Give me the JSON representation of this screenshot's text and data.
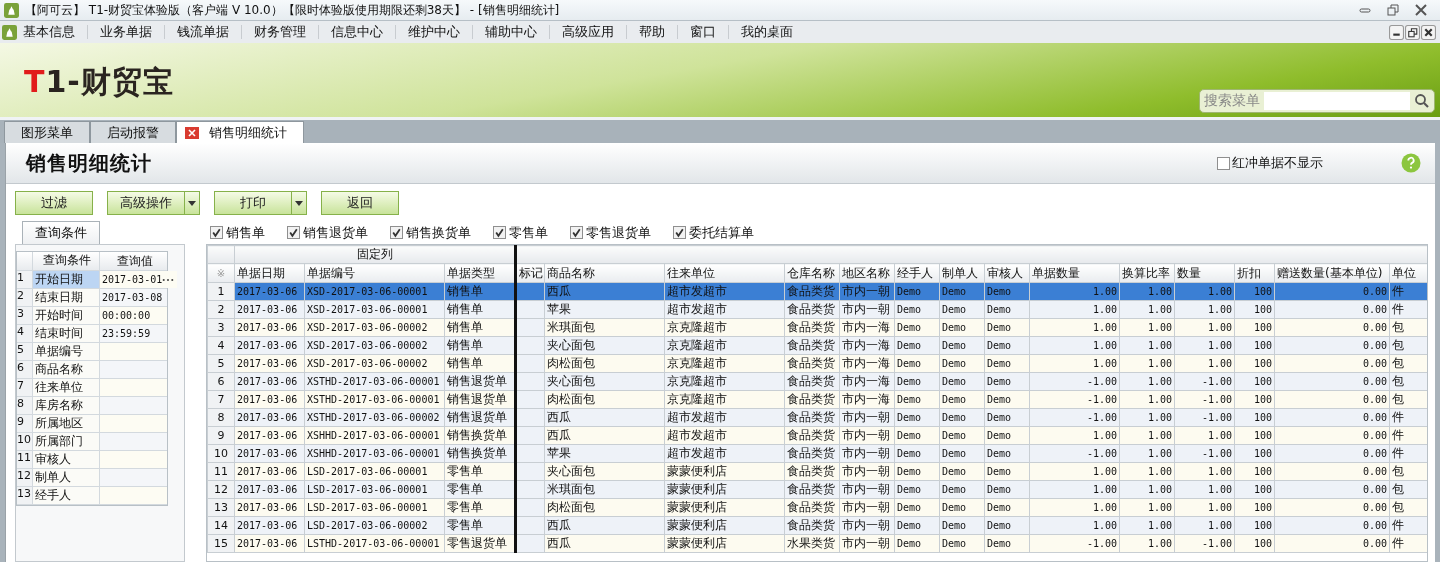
{
  "window": {
    "title": "【阿可云】 T1-财贸宝体验版（客户端 V 10.0）【限时体验版使用期限还剩38天】 - [销售明细统计]"
  },
  "menu": [
    "基本信息",
    "业务单据",
    "钱流单据",
    "财务管理",
    "信息中心",
    "维护中心",
    "辅助中心",
    "高级应用",
    "帮助",
    "窗口",
    "我的桌面"
  ],
  "logo": {
    "mark": "T",
    "text": "1-财贸宝"
  },
  "search": {
    "label": "搜索菜单"
  },
  "tabs": [
    {
      "label": "图形菜单",
      "selected": false,
      "closable": false
    },
    {
      "label": "启动报警",
      "selected": false,
      "closable": false
    },
    {
      "label": "销售明细统计",
      "selected": true,
      "closable": true
    }
  ],
  "page": {
    "title": "销售明细统计",
    "hide_red": {
      "label": "红冲单据不显示",
      "checked": false
    }
  },
  "buttons": [
    {
      "label": "过滤",
      "dropdown": false
    },
    {
      "label": "高级操作",
      "dropdown": true
    },
    {
      "label": "打印",
      "dropdown": true
    },
    {
      "label": "返回",
      "dropdown": false
    }
  ],
  "query": {
    "tab": "查询条件",
    "columns": [
      "查询条件",
      "查询值"
    ],
    "rows": [
      {
        "num": "1",
        "label": "开始日期",
        "value": "2017-03-01",
        "selected": true
      },
      {
        "num": "2",
        "label": "结束日期",
        "value": "2017-03-08",
        "selected": false
      },
      {
        "num": "3",
        "label": "开始时间",
        "value": "00:00:00",
        "selected": false
      },
      {
        "num": "4",
        "label": "结束时间",
        "value": "23:59:59",
        "selected": false
      },
      {
        "num": "5",
        "label": "单据编号",
        "selected": false
      },
      {
        "num": "6",
        "label": "商品名称",
        "selected": false
      },
      {
        "num": "7",
        "label": "往来单位",
        "selected": false
      },
      {
        "num": "8",
        "label": "库房名称",
        "selected": false
      },
      {
        "num": "9",
        "label": "所属地区",
        "selected": false
      },
      {
        "num": "10",
        "label": "所属部门",
        "selected": false
      },
      {
        "num": "11",
        "label": "审核人",
        "selected": false
      },
      {
        "num": "12",
        "label": "制单人",
        "selected": false
      },
      {
        "num": "13",
        "label": "经手人",
        "selected": false
      }
    ]
  },
  "filters": [
    {
      "label": "销售单",
      "checked": true
    },
    {
      "label": "销售退货单",
      "checked": true
    },
    {
      "label": "销售换货单",
      "checked": true
    },
    {
      "label": "零售单",
      "checked": true
    },
    {
      "label": "零售退货单",
      "checked": true
    },
    {
      "label": "委托结算单",
      "checked": true
    }
  ],
  "table": {
    "fixed_label": "固定列",
    "corner": "※",
    "fixed_columns": [
      {
        "label": "单据日期",
        "kind": "mono"
      },
      {
        "label": "单据编号",
        "kind": "mono"
      },
      {
        "label": "单据类型",
        "kind": "text"
      }
    ],
    "columns": [
      {
        "label": "标记",
        "kind": "mark"
      },
      {
        "label": "商品名称",
        "kind": "text"
      },
      {
        "label": "往来单位",
        "kind": "text"
      },
      {
        "label": "仓库名称",
        "kind": "text"
      },
      {
        "label": "地区名称",
        "kind": "text"
      },
      {
        "label": "经手人",
        "kind": "mono"
      },
      {
        "label": "制单人",
        "kind": "mono"
      },
      {
        "label": "审核人",
        "kind": "mono"
      },
      {
        "label": "单据数量",
        "kind": "number"
      },
      {
        "label": "换算比率",
        "kind": "number"
      },
      {
        "label": "数量",
        "kind": "number"
      },
      {
        "label": "折扣",
        "kind": "number"
      },
      {
        "label": "赠送数量(基本单位)",
        "kind": "number"
      },
      {
        "label": "单位",
        "kind": "text"
      }
    ],
    "rows": [
      {
        "num": "1",
        "selected": true,
        "fixed_cells": [
          "2017-03-06",
          "XSD-2017-03-06-00001",
          "销售单"
        ],
        "cells": [
          "",
          "西瓜",
          "超市发超市",
          "食品类货",
          "市内一朝",
          "Demo",
          "Demo",
          "Demo",
          "1.00",
          "1.00",
          "1.00",
          "100",
          "0.00",
          "件"
        ]
      },
      {
        "num": "2",
        "selected": false,
        "fixed_cells": [
          "2017-03-06",
          "XSD-2017-03-06-00001",
          "销售单"
        ],
        "cells": [
          "",
          "苹果",
          "超市发超市",
          "食品类货",
          "市内一朝",
          "Demo",
          "Demo",
          "Demo",
          "1.00",
          "1.00",
          "1.00",
          "100",
          "0.00",
          "件"
        ]
      },
      {
        "num": "3",
        "selected": false,
        "fixed_cells": [
          "2017-03-06",
          "XSD-2017-03-06-00002",
          "销售单"
        ],
        "cells": [
          "",
          "米琪面包",
          "京克隆超市",
          "食品类货",
          "市内一海",
          "Demo",
          "Demo",
          "Demo",
          "1.00",
          "1.00",
          "1.00",
          "100",
          "0.00",
          "包"
        ]
      },
      {
        "num": "4",
        "selected": false,
        "fixed_cells": [
          "2017-03-06",
          "XSD-2017-03-06-00002",
          "销售单"
        ],
        "cells": [
          "",
          "夹心面包",
          "京克隆超市",
          "食品类货",
          "市内一海",
          "Demo",
          "Demo",
          "Demo",
          "1.00",
          "1.00",
          "1.00",
          "100",
          "0.00",
          "包"
        ]
      },
      {
        "num": "5",
        "selected": false,
        "fixed_cells": [
          "2017-03-06",
          "XSD-2017-03-06-00002",
          "销售单"
        ],
        "cells": [
          "",
          "肉松面包",
          "京克隆超市",
          "食品类货",
          "市内一海",
          "Demo",
          "Demo",
          "Demo",
          "1.00",
          "1.00",
          "1.00",
          "100",
          "0.00",
          "包"
        ]
      },
      {
        "num": "6",
        "selected": false,
        "fixed_cells": [
          "2017-03-06",
          "XSTHD-2017-03-06-00001",
          "销售退货单"
        ],
        "cells": [
          "",
          "夹心面包",
          "京克隆超市",
          "食品类货",
          "市内一海",
          "Demo",
          "Demo",
          "Demo",
          "-1.00",
          "1.00",
          "-1.00",
          "100",
          "0.00",
          "包"
        ]
      },
      {
        "num": "7",
        "selected": false,
        "fixed_cells": [
          "2017-03-06",
          "XSTHD-2017-03-06-00001",
          "销售退货单"
        ],
        "cells": [
          "",
          "肉松面包",
          "京克隆超市",
          "食品类货",
          "市内一海",
          "Demo",
          "Demo",
          "Demo",
          "-1.00",
          "1.00",
          "-1.00",
          "100",
          "0.00",
          "包"
        ]
      },
      {
        "num": "8",
        "selected": false,
        "fixed_cells": [
          "2017-03-06",
          "XSTHD-2017-03-06-00002",
          "销售退货单"
        ],
        "cells": [
          "",
          "西瓜",
          "超市发超市",
          "食品类货",
          "市内一朝",
          "Demo",
          "Demo",
          "Demo",
          "-1.00",
          "1.00",
          "-1.00",
          "100",
          "0.00",
          "件"
        ]
      },
      {
        "num": "9",
        "selected": false,
        "fixed_cells": [
          "2017-03-06",
          "XSHHD-2017-03-06-00001",
          "销售换货单"
        ],
        "cells": [
          "",
          "西瓜",
          "超市发超市",
          "食品类货",
          "市内一朝",
          "Demo",
          "Demo",
          "Demo",
          "1.00",
          "1.00",
          "1.00",
          "100",
          "0.00",
          "件"
        ]
      },
      {
        "num": "10",
        "selected": false,
        "fixed_cells": [
          "2017-03-06",
          "XSHHD-2017-03-06-00001",
          "销售换货单"
        ],
        "cells": [
          "",
          "苹果",
          "超市发超市",
          "食品类货",
          "市内一朝",
          "Demo",
          "Demo",
          "Demo",
          "-1.00",
          "1.00",
          "-1.00",
          "100",
          "0.00",
          "件"
        ]
      },
      {
        "num": "11",
        "selected": false,
        "fixed_cells": [
          "2017-03-06",
          "LSD-2017-03-06-00001",
          "零售单"
        ],
        "cells": [
          "",
          "夹心面包",
          "蒙蒙便利店",
          "食品类货",
          "市内一朝",
          "Demo",
          "Demo",
          "Demo",
          "1.00",
          "1.00",
          "1.00",
          "100",
          "0.00",
          "包"
        ]
      },
      {
        "num": "12",
        "selected": false,
        "fixed_cells": [
          "2017-03-06",
          "LSD-2017-03-06-00001",
          "零售单"
        ],
        "cells": [
          "",
          "米琪面包",
          "蒙蒙便利店",
          "食品类货",
          "市内一朝",
          "Demo",
          "Demo",
          "Demo",
          "1.00",
          "1.00",
          "1.00",
          "100",
          "0.00",
          "包"
        ]
      },
      {
        "num": "13",
        "selected": false,
        "fixed_cells": [
          "2017-03-06",
          "LSD-2017-03-06-00001",
          "零售单"
        ],
        "cells": [
          "",
          "肉松面包",
          "蒙蒙便利店",
          "食品类货",
          "市内一朝",
          "Demo",
          "Demo",
          "Demo",
          "1.00",
          "1.00",
          "1.00",
          "100",
          "0.00",
          "包"
        ]
      },
      {
        "num": "14",
        "selected": false,
        "fixed_cells": [
          "2017-03-06",
          "LSD-2017-03-06-00002",
          "零售单"
        ],
        "cells": [
          "",
          "西瓜",
          "蒙蒙便利店",
          "食品类货",
          "市内一朝",
          "Demo",
          "Demo",
          "Demo",
          "1.00",
          "1.00",
          "1.00",
          "100",
          "0.00",
          "件"
        ]
      },
      {
        "num": "15",
        "selected": false,
        "fixed_cells": [
          "2017-03-06",
          "LSTHD-2017-03-06-00001",
          "零售退货单"
        ],
        "cells": [
          "",
          "西瓜",
          "蒙蒙便利店",
          "水果类货",
          "市内一朝",
          "Demo",
          "Demo",
          "Demo",
          "-1.00",
          "1.00",
          "-1.00",
          "100",
          "0.00",
          "件"
        ]
      }
    ]
  }
}
